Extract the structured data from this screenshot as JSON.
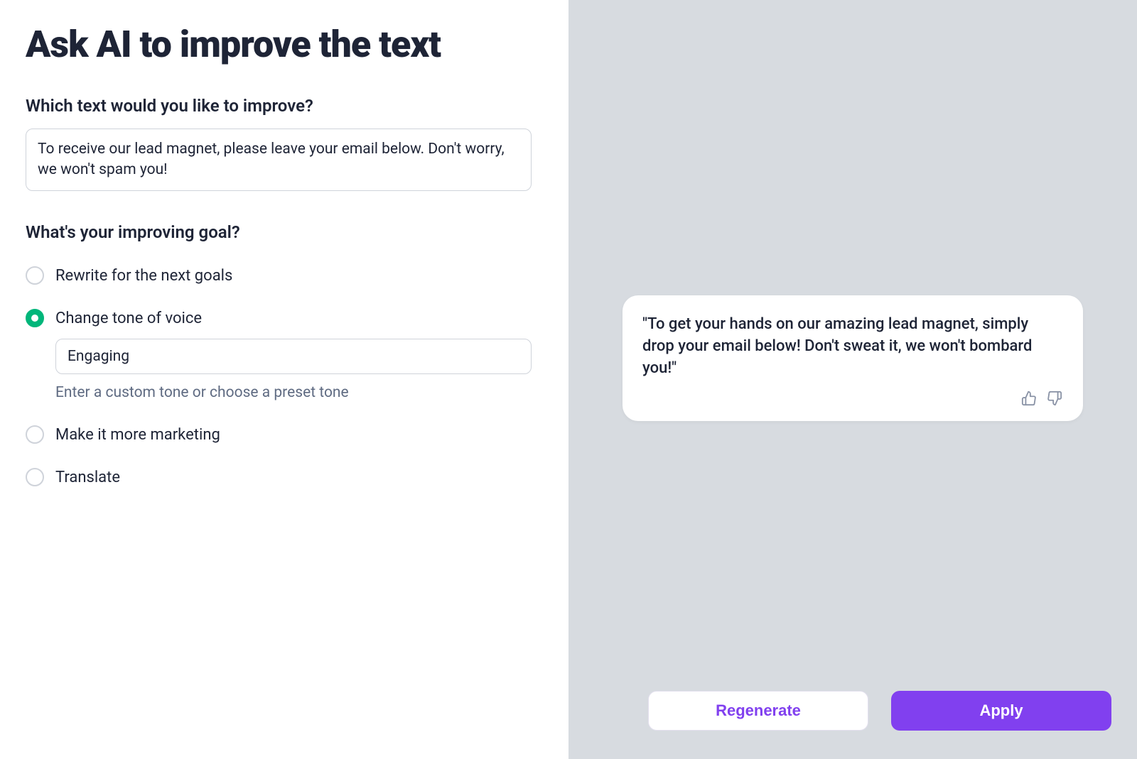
{
  "title": "Ask AI to improve the text",
  "input_section": {
    "label": "Which text would you like to improve?",
    "value": "To receive our lead magnet, please leave your email below. Don't worry, we won't spam you!"
  },
  "goal_section": {
    "label": "What's your improving goal?",
    "options": {
      "rewrite": {
        "label": "Rewrite for the next goals",
        "selected": false
      },
      "tone": {
        "label": "Change tone of voice",
        "selected": true,
        "value": "Engaging",
        "hint": "Enter a custom tone or choose a preset tone"
      },
      "marketing": {
        "label": "Make it more marketing",
        "selected": false
      },
      "translate": {
        "label": "Translate",
        "selected": false
      }
    }
  },
  "result": {
    "text": "\"To get your hands on our amazing lead magnet, simply drop your email below! Don't sweat it, we won't bombard you!\""
  },
  "buttons": {
    "regenerate": "Regenerate",
    "apply": "Apply"
  }
}
